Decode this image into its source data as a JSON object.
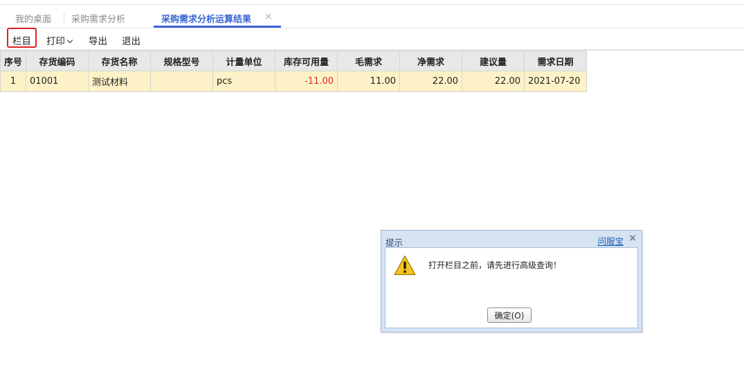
{
  "tabs": [
    {
      "label": "我的桌面"
    },
    {
      "label": "采购需求分析"
    },
    {
      "label": "采购需求分析运算结果",
      "active": true
    }
  ],
  "tab_close_symbol": "×",
  "toolbar": {
    "columns_label": "栏目",
    "print_label": "打印",
    "export_label": "导出",
    "exit_label": "退出"
  },
  "grid": {
    "headers": [
      "序号",
      "存货编码",
      "存货名称",
      "规格型号",
      "计量单位",
      "库存可用量",
      "毛需求",
      "净需求",
      "建议量",
      "需求日期"
    ],
    "rows": [
      [
        "1",
        "01001",
        "测试材料",
        "",
        "pcs",
        "-11.00",
        "11.00",
        "22.00",
        "22.00",
        "2021-07-20"
      ]
    ]
  },
  "dialog": {
    "title": "提示",
    "help_link": "问服宝",
    "close_symbol": "×",
    "message": "打开栏目之前，请先进行高级查询！",
    "ok_label": "确定(O)"
  },
  "colors": {
    "accent": "#3a66d4",
    "highlight_border": "#e02020",
    "negative": "#e02a2a",
    "row_bg": "#fdf2c7",
    "warning": "#f5c518"
  },
  "icons": {
    "dialog_icon": "warning-triangle-icon",
    "print_dropdown": "chevron-down-icon"
  }
}
